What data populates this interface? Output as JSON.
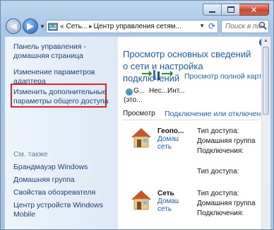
{
  "window": {
    "buttons": {
      "minimize": "minimize-icon",
      "maximize": "maximize-icon",
      "close": "close-icon"
    }
  },
  "nav": {
    "back": "◀",
    "forward": "▶",
    "address": {
      "prefix": "«",
      "crumbs": [
        "Сеть...",
        "Центр управления сетям..."
      ],
      "separator": "▸"
    },
    "search_placeholder": "Поиск в пан..."
  },
  "sidebar": {
    "links": [
      "Панель управления - домашняя страница",
      "Изменение параметров адаптера",
      "Изменить дополнительные параметры общего доступа"
    ],
    "see_also_title": "См. также",
    "see_also": [
      "Брандмауэр Windows",
      "Домашняя группа",
      "Свойства обозревателя",
      "Центр устройств Windows Mobile"
    ]
  },
  "main": {
    "help": "?",
    "heading": "Просмотр основных сведений о сети и настройка подключений",
    "map_link": "Просмотр полной карты",
    "map_nodes": [
      "G...",
      "(это...",
      "Нес...",
      "Инт..."
    ],
    "view_label": "Просмотр",
    "connect_link": "Подключение или отключение",
    "networks": [
      {
        "name": "Геопо...",
        "type_lines": [
          "Домаш",
          "сеть"
        ],
        "labels": [
          "Тип доступа:",
          "Домашняя группа",
          "Подключения:"
        ],
        "values": [
          "",
          "",
          ""
        ]
      },
      {
        "name": "Сеть",
        "type_lines": [
          "Домаш",
          "сеть"
        ],
        "labels": [
          "Тип доступа:",
          "Домашняя группа",
          "Подключения:"
        ],
        "values": [
          "",
          "",
          ""
        ]
      }
    ],
    "orphan_label": "Тип доступа:"
  },
  "colors": {
    "accent": "#1e5aa8",
    "link": "#1c5fb5",
    "highlight": "#d9252a"
  }
}
